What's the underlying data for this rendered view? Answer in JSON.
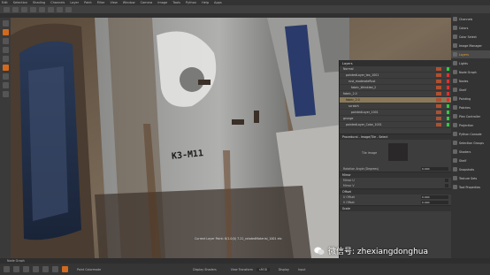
{
  "menubar": {
    "items": [
      "Edit",
      "Selection",
      "Shading",
      "Channels",
      "Layer",
      "Paint",
      "Filter",
      "View",
      "Window",
      "Camera",
      "Image",
      "Tools",
      "Python",
      "Help",
      "Apps"
    ]
  },
  "right_panel": {
    "items": [
      {
        "label": "Channels",
        "active": false
      },
      {
        "label": "Colors",
        "active": false
      },
      {
        "label": "Color Select",
        "active": false
      },
      {
        "label": "Image Manager",
        "active": false
      },
      {
        "label": "Layers",
        "active": true
      },
      {
        "label": "Lights",
        "active": false
      },
      {
        "label": "Node Graph",
        "active": false
      },
      {
        "label": "Nodes",
        "active": false
      },
      {
        "label": "Shelf",
        "active": false
      },
      {
        "label": "Painting",
        "active": false
      },
      {
        "label": "Patches",
        "active": false
      },
      {
        "label": "Plex Controller",
        "active": false
      },
      {
        "label": "Projection",
        "active": false
      },
      {
        "label": "Python Console",
        "active": false
      },
      {
        "label": "Selection Groups",
        "active": false
      },
      {
        "label": "Shaders",
        "active": false
      },
      {
        "label": "Shelf",
        "active": false
      },
      {
        "label": "Snapshots",
        "active": false
      },
      {
        "label": "Texture Sets",
        "active": false
      },
      {
        "label": "Tool Properties",
        "active": false
      }
    ]
  },
  "layers": {
    "title": "Layers",
    "rows": [
      {
        "label": "Normal",
        "selected": false,
        "vis": "#2ecc40"
      },
      {
        "label": "paintedLayer_tex_1001",
        "selected": false,
        "vis": "#e03030"
      },
      {
        "label": "rust_moderateRust",
        "selected": false,
        "vis": "#e03030"
      },
      {
        "label": "fabric_Wrinkled_2",
        "selected": false,
        "vis": "#e03030"
      },
      {
        "label": "fabric_2.0",
        "selected": false,
        "vis": "#e03030"
      },
      {
        "label": "fabric_2.0",
        "selected": true,
        "vis": "#e03030"
      },
      {
        "label": "scratch",
        "selected": false,
        "vis": "#2ecc40"
      },
      {
        "label": "paintedLayer_1001",
        "selected": false,
        "vis": "#2ecc40"
      },
      {
        "label": "grunge",
        "selected": false,
        "vis": "#2ecc40"
      },
      {
        "label": "paintedLayer_Color_1001",
        "selected": false,
        "vis": "#2ecc40"
      }
    ]
  },
  "properties": {
    "section_procedural": "Procedural - Image/Tile - Select",
    "image_label": "Tile Image",
    "rotation_angle_label": "Rotation Angle (Degrees)",
    "rotation_angle_value": "0.000",
    "mirror_label": "Mirror",
    "mirror_u": "Mirror U",
    "mirror_v": "Mirror V",
    "offset_label": "Offset",
    "offset_u_label": "U Offset",
    "offset_u_value": "0.000",
    "offset_v_label": "V Offset",
    "offset_v_value": "0.000",
    "scale_label": "Scale"
  },
  "viewport": {
    "stencil_text": "K3-M11",
    "status": "Current Layer Paint: 6/1.0(0) 7.22_rotatedMaterial_1001 etc"
  },
  "bottom": {
    "tab_label": "Node Graph",
    "paint_label": "Paint Colormode",
    "shaders_label": "Display Shaders",
    "view_transform_label": "View Transform",
    "view_transform_value": "sRGB",
    "display_label": "Display",
    "input_label": "Input"
  },
  "watermark": {
    "text": "微信号: zhexiangdonghua"
  },
  "colors": {
    "accent": "#d2691e",
    "visible_green": "#2ecc40",
    "hidden_red": "#e03030"
  }
}
